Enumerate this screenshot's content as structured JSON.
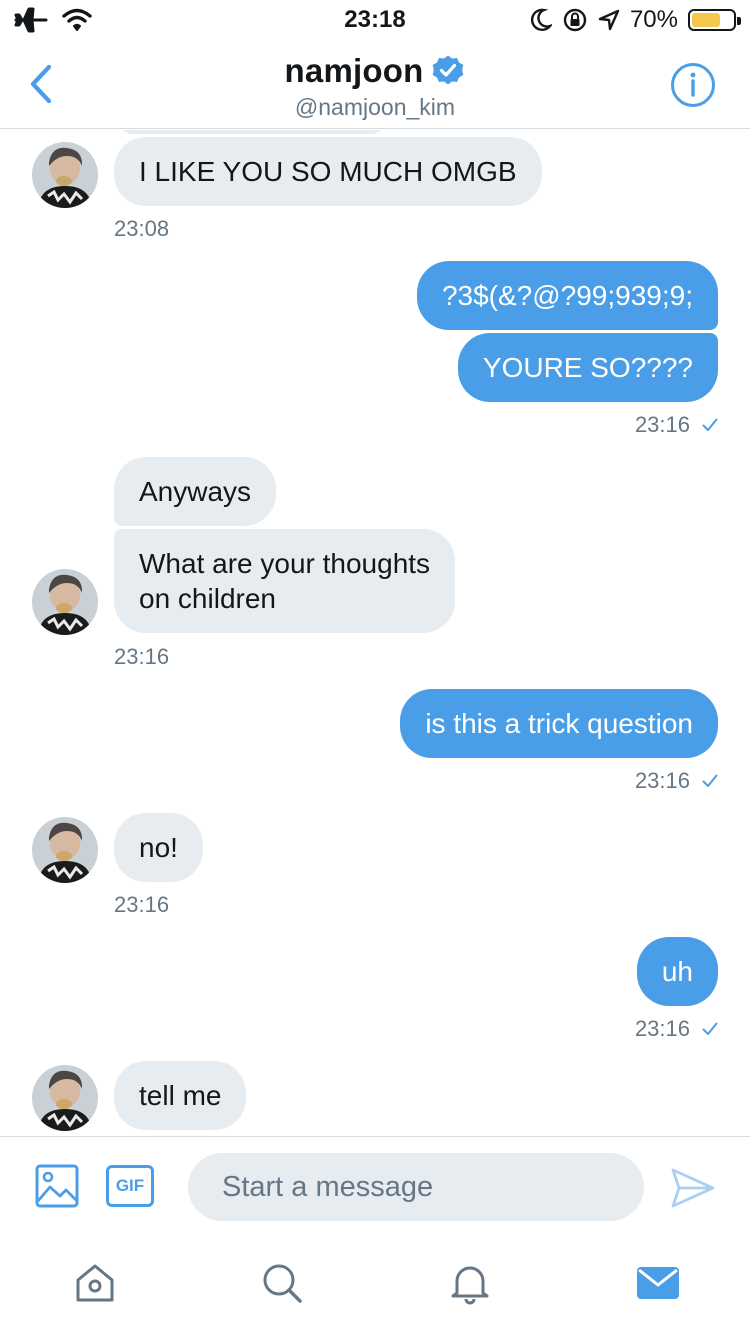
{
  "status_bar": {
    "time": "23:18",
    "battery_percent": "70%",
    "battery_level": 0.7,
    "left_icons": [
      "airplane-icon",
      "wifi-icon"
    ],
    "right_icons": [
      "moon-icon",
      "rotation-lock-icon",
      "location-icon"
    ]
  },
  "header": {
    "name": "namjoon",
    "handle": "@namjoon_kim",
    "verified": true,
    "back_icon": "chevron-left-icon",
    "info_icon": "info-icon"
  },
  "colors": {
    "accent": "#4a9ee7",
    "incoming_bubble": "#e6ecf0",
    "secondary_text": "#657786"
  },
  "messages": [
    {
      "direction": "in",
      "text": "I LIKE YOU SO MUCH OMGB"
    },
    {
      "direction": "in",
      "timestamp": "23:08"
    },
    {
      "direction": "out",
      "text": "?3$(&?@?99;939;9;"
    },
    {
      "direction": "out",
      "text": "YOURE SO????"
    },
    {
      "direction": "out",
      "timestamp": "23:16"
    },
    {
      "direction": "in",
      "text": "Anyways"
    },
    {
      "direction": "in",
      "text": "What are your thoughts\non children"
    },
    {
      "direction": "in",
      "timestamp": "23:16"
    },
    {
      "direction": "out",
      "text": "is this a trick question"
    },
    {
      "direction": "out",
      "timestamp": "23:16"
    },
    {
      "direction": "in",
      "text": "no!"
    },
    {
      "direction": "in",
      "timestamp": "23:16"
    },
    {
      "direction": "out",
      "text": "uh"
    },
    {
      "direction": "out",
      "timestamp": "23:16"
    },
    {
      "direction": "in",
      "text": "tell me"
    }
  ],
  "composer": {
    "placeholder": "Start a message",
    "gif_label": "GIF"
  },
  "tabs": [
    "home-icon",
    "search-icon",
    "notifications-icon",
    "messages-icon"
  ]
}
